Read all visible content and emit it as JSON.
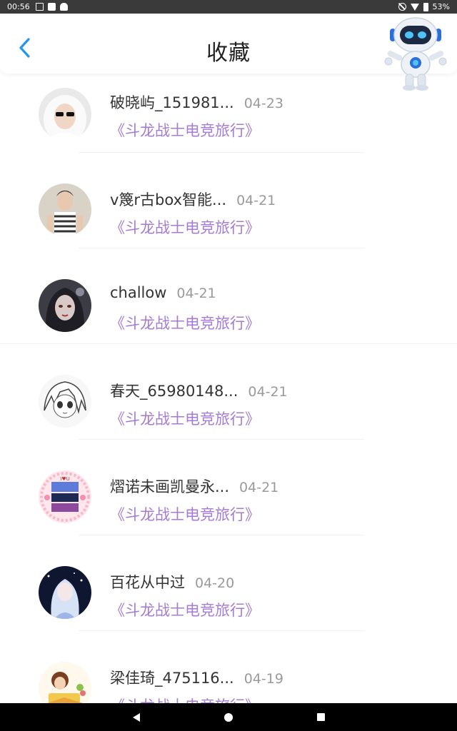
{
  "status_bar": {
    "time": "00:56",
    "battery": "53%"
  },
  "header": {
    "title": "收藏"
  },
  "favorites": [
    {
      "name": "破晓屿_151981...",
      "date": "04-23",
      "game": "《斗龙战士电竞旅行》"
    },
    {
      "name": "v篾r古box智能...",
      "date": "04-21",
      "game": "《斗龙战士电竞旅行》"
    },
    {
      "name": "challow",
      "date": "04-21",
      "game": "《斗龙战士电竞旅行》"
    },
    {
      "name": "春天_65980148...",
      "date": "04-21",
      "game": "《斗龙战士电竞旅行》"
    },
    {
      "name": "熠诺未画凯曼永...",
      "date": "04-21",
      "game": "《斗龙战士电竞旅行》"
    },
    {
      "name": "百花从中过",
      "date": "04-20",
      "game": "《斗龙战士电竞旅行》"
    },
    {
      "name": "梁佳琦_475116...",
      "date": "04-19",
      "game": "《斗龙战士电竞旅行》"
    }
  ],
  "colors": {
    "accent": "#2196f3",
    "game_title": "#a57bd5",
    "date": "#9a9a9a"
  },
  "icons": {
    "back": "chevron-left-icon",
    "mascot": "robot-icon"
  }
}
